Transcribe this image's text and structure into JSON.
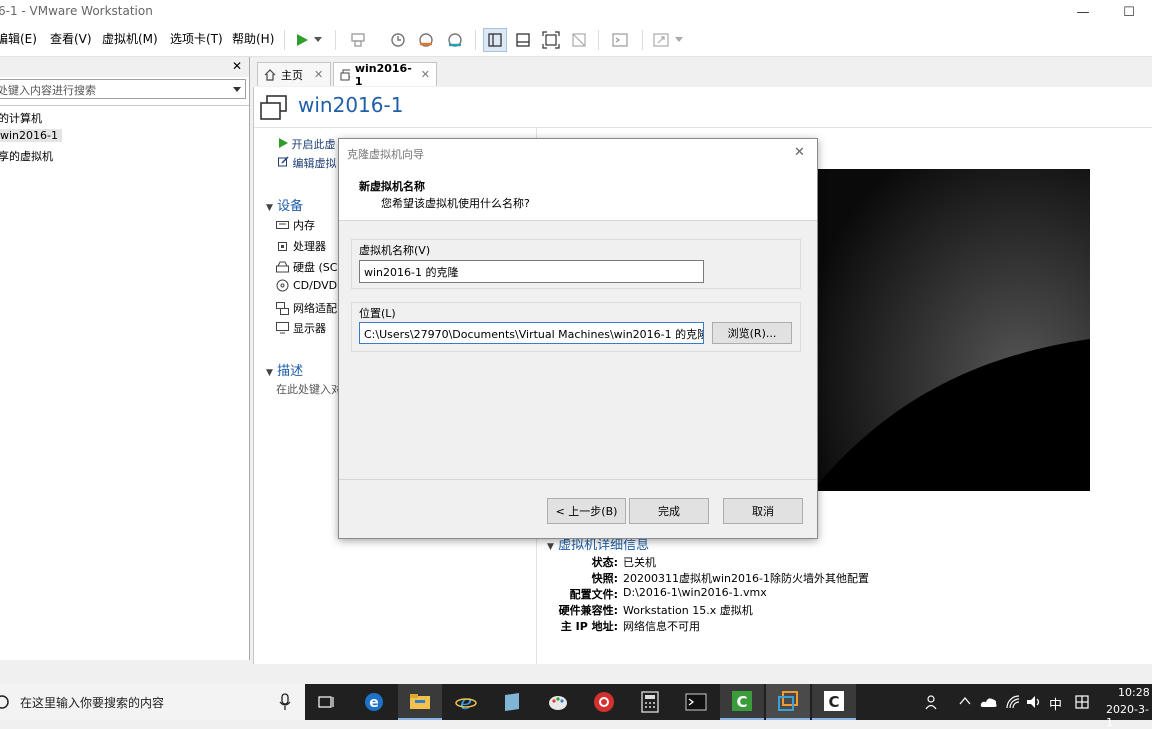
{
  "window": {
    "title": "6-1 - VMware Workstation",
    "minimize": "—",
    "maximize": "☐"
  },
  "menu": [
    "编辑(E)",
    "查看(V)",
    "虚拟机(M)",
    "选项卡(T)",
    "帮助(H)"
  ],
  "library": {
    "close": "✕",
    "search_placeholder": "处键入内容进行搜索",
    "tree": [
      "的计算机",
      "win2016-1",
      "享的虚拟机"
    ]
  },
  "tabs": [
    {
      "label": "主页",
      "close": "✕"
    },
    {
      "label": "win2016-1",
      "close": "✕"
    }
  ],
  "vm": {
    "title": "win2016-1",
    "actions": [
      "开启此虚",
      "编辑虚拟"
    ],
    "devices_header": "设备",
    "devices": [
      "内存",
      "处理器",
      "硬盘 (SC",
      "CD/DVD",
      "网络适配",
      "显示器"
    ],
    "desc_header": "描述",
    "desc_placeholder": "在此处键入对",
    "details_header": "虚拟机详细信息",
    "details": [
      {
        "label": "状态:",
        "value": "已关机"
      },
      {
        "label": "快照:",
        "value": "20200311虚拟机win2016-1除防火墙外其他配置"
      },
      {
        "label": "配置文件:",
        "value": "D:\\2016-1\\win2016-1.vmx"
      },
      {
        "label": "硬件兼容性:",
        "value": "Workstation 15.x 虚拟机"
      },
      {
        "label": "主 IP 地址:",
        "value": "网络信息不可用"
      }
    ]
  },
  "dialog": {
    "title": "克隆虚拟机向导",
    "close": "✕",
    "heading": "新虚拟机名称",
    "subheading": "您希望该虚拟机使用什么名称?",
    "name_label": "虚拟机名称(V)",
    "name_value": "win2016-1 的克隆",
    "location_label": "位置(L)",
    "location_value": "C:\\Users\\27970\\Documents\\Virtual Machines\\win2016-1 的克隆",
    "browse": "浏览(R)...",
    "back": "< 上一步(B)",
    "finish": "完成",
    "cancel": "取消"
  },
  "taskbar": {
    "search_placeholder": "在这里输入你要搜索的内容",
    "ime": "中",
    "time": "10:28",
    "date": "2020-3-1"
  },
  "colors": {
    "accent": "#1f5fa8",
    "play": "#2f9e2f",
    "taskbar": "#202020"
  }
}
